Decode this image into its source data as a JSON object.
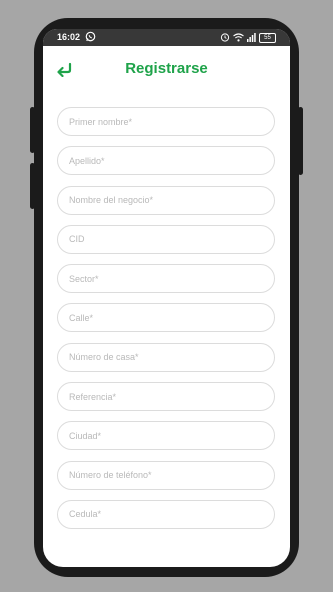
{
  "status_bar": {
    "time": "16:02",
    "left_icons": [
      "whatsapp-icon"
    ],
    "right_icons": [
      "alarm-icon",
      "wifi-icon",
      "signal-icon",
      "battery-icon"
    ],
    "battery_level": "55"
  },
  "header": {
    "title": "Registrarse",
    "back_icon": "back-arrow-icon",
    "accent_color": "#1fa34a"
  },
  "form": {
    "fields": [
      {
        "name": "primer-nombre",
        "placeholder": "Primer nombre*"
      },
      {
        "name": "apellido",
        "placeholder": "Apellido*"
      },
      {
        "name": "nombre-negocio",
        "placeholder": "Nombre del negocio*"
      },
      {
        "name": "cid",
        "placeholder": "CID"
      },
      {
        "name": "sector",
        "placeholder": "Sector*"
      },
      {
        "name": "calle",
        "placeholder": "Calle*"
      },
      {
        "name": "numero-casa",
        "placeholder": "Número de casa*"
      },
      {
        "name": "referencia",
        "placeholder": "Referencia*"
      },
      {
        "name": "ciudad",
        "placeholder": "Ciudad*"
      },
      {
        "name": "numero-telefono",
        "placeholder": "Número de teléfono*"
      },
      {
        "name": "cedula",
        "placeholder": "Cedula*"
      }
    ]
  }
}
